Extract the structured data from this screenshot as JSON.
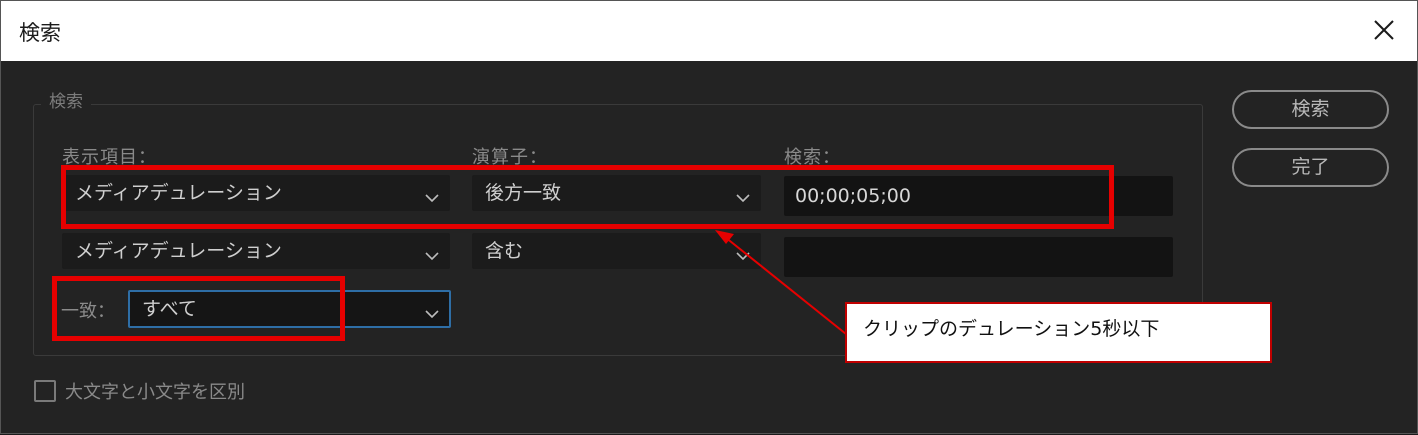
{
  "window": {
    "title": "検索",
    "close_icon": "close-icon"
  },
  "group": {
    "legend": "検索"
  },
  "columns": {
    "display_item": "表示項目：",
    "operator": "演算子：",
    "search": "検索："
  },
  "rows": [
    {
      "item": "メディアデュレーション",
      "operator": "後方一致",
      "value": "00;00;05;00"
    },
    {
      "item": "メディアデュレーション",
      "operator": "含む",
      "value": ""
    }
  ],
  "match": {
    "label": "一致：",
    "value": "すべて"
  },
  "buttons": {
    "search": "検索",
    "done": "完了"
  },
  "checkbox": {
    "label": "大文字と小文字を区別",
    "checked": false
  },
  "annotation": {
    "callout_text": "クリップのデュレーション5秒以下",
    "color": "#e60000"
  },
  "colors": {
    "background": "#232323",
    "field": "#1b1b1b",
    "focus_border": "#2e6ea6"
  }
}
